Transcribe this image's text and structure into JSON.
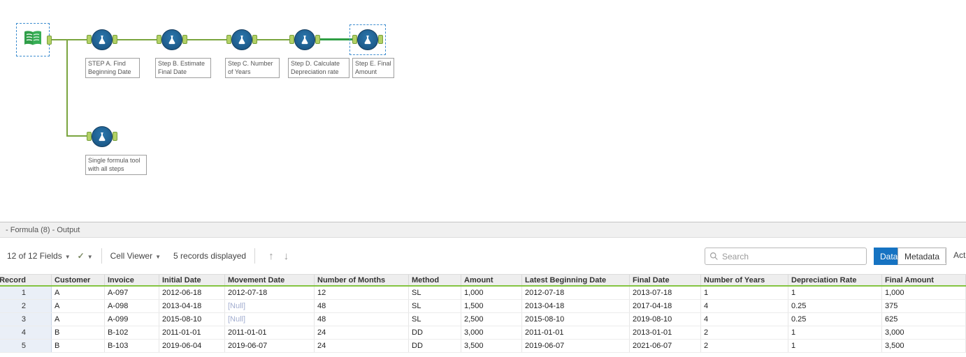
{
  "canvas": {
    "tool_labels": {
      "step_a": "STEP A. Find Beginning Date",
      "step_b": "Step B. Estimate Final Date",
      "step_c": "Step C. Number of Years",
      "step_d": "Step D. Calculate Depreciation rate",
      "step_e": "Step E. Final Amount",
      "single": "Single formula tool with all steps"
    }
  },
  "results": {
    "title": "- Formula (8) - Output",
    "toolbar": {
      "fields_summary": "12 of 12 Fields",
      "cell_viewer": "Cell Viewer",
      "records_displayed": "5 records displayed",
      "search_placeholder": "Search",
      "data_button": "Data",
      "metadata_button": "Metadata",
      "actions": "Actions"
    },
    "table": {
      "columns": [
        "Record",
        "Customer",
        "Invoice",
        "Initial Date",
        "Movement Date",
        "Number of Months",
        "Method",
        "Amount",
        "Latest Beginning Date",
        "Final Date",
        "Number of Years",
        "Depreciation Rate",
        "Final Amount"
      ],
      "rows": [
        [
          "1",
          "A",
          "A-097",
          "2012-06-18",
          "2012-07-18",
          "12",
          "SL",
          "1,000",
          "2012-07-18",
          "2013-07-18",
          "1",
          "1",
          "1,000"
        ],
        [
          "2",
          "A",
          "A-098",
          "2013-04-18",
          "[Null]",
          "48",
          "SL",
          "1,500",
          "2013-04-18",
          "2017-04-18",
          "4",
          "0.25",
          "375"
        ],
        [
          "3",
          "A",
          "A-099",
          "2015-08-10",
          "[Null]",
          "48",
          "SL",
          "2,500",
          "2015-08-10",
          "2019-08-10",
          "4",
          "0.25",
          "625"
        ],
        [
          "4",
          "B",
          "B-102",
          "2011-01-01",
          "2011-01-01",
          "24",
          "DD",
          "3,000",
          "2011-01-01",
          "2013-01-01",
          "2",
          "1",
          "3,000"
        ],
        [
          "5",
          "B",
          "B-103",
          "2019-06-04",
          "2019-06-07",
          "24",
          "DD",
          "3,500",
          "2019-06-07",
          "2021-06-07",
          "2",
          "1",
          "3,500"
        ]
      ]
    }
  },
  "colors": {
    "accent_blue": "#1673c2",
    "tool_blue": "#1b6094",
    "anchor_green": "#b3d165",
    "wire_green": "#7aa53f",
    "header_underline_green": "#84c441"
  }
}
